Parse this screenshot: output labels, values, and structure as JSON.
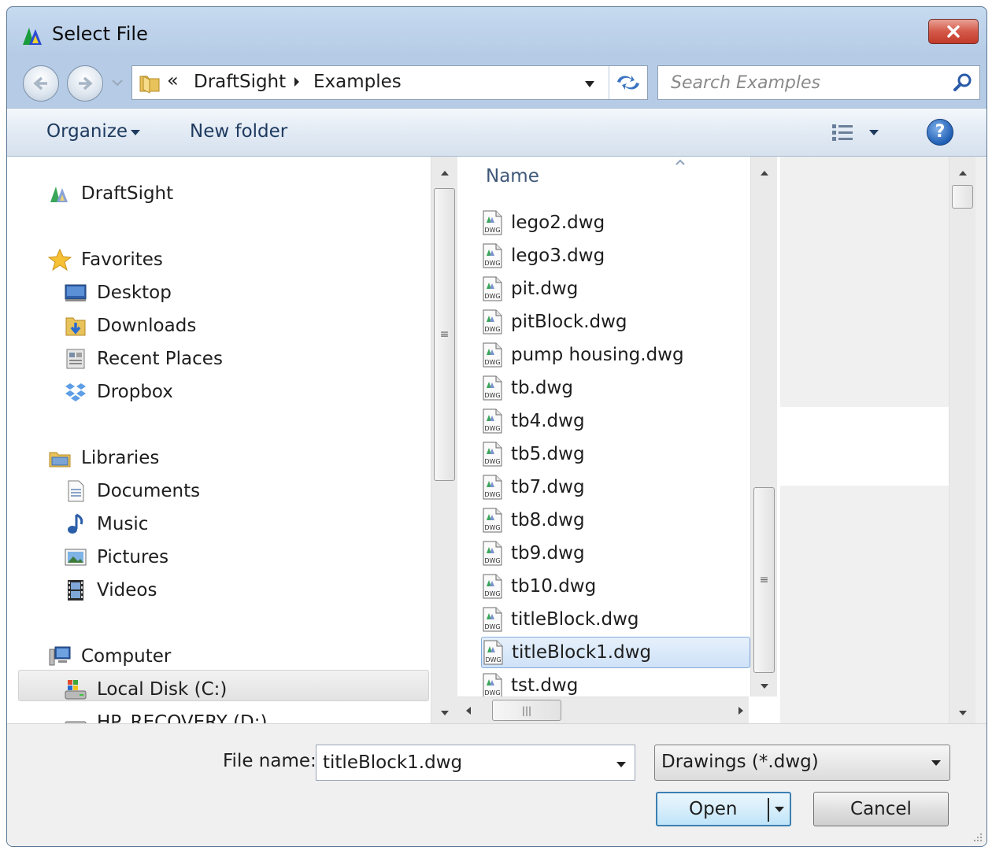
{
  "window": {
    "title": "Select File"
  },
  "address": {
    "overflow": "«",
    "crumbs": [
      "DraftSight",
      "Examples"
    ]
  },
  "search": {
    "placeholder": "Search Examples"
  },
  "toolbar": {
    "organize": "Organize",
    "new_folder": "New folder"
  },
  "nav": {
    "items": [
      {
        "label": "DraftSight",
        "icon": "draftsight-icon"
      },
      {
        "label": "Favorites",
        "icon": "star-icon"
      },
      {
        "label": "Desktop",
        "icon": "desktop-icon"
      },
      {
        "label": "Downloads",
        "icon": "downloads-icon"
      },
      {
        "label": "Recent Places",
        "icon": "recent-places-icon"
      },
      {
        "label": "Dropbox",
        "icon": "dropbox-icon"
      },
      {
        "label": "Libraries",
        "icon": "libraries-icon"
      },
      {
        "label": "Documents",
        "icon": "documents-icon"
      },
      {
        "label": "Music",
        "icon": "music-icon"
      },
      {
        "label": "Pictures",
        "icon": "pictures-icon"
      },
      {
        "label": "Videos",
        "icon": "videos-icon"
      },
      {
        "label": "Computer",
        "icon": "computer-icon"
      },
      {
        "label": "Local Disk (C:)",
        "icon": "local-disk-icon"
      },
      {
        "label": "HP_RECOVERY (D:)",
        "icon": "drive-icon"
      }
    ],
    "selected": "Local Disk (C:)"
  },
  "files": {
    "column_header": "Name",
    "items": [
      "lego2.dwg",
      "lego3.dwg",
      "pit.dwg",
      "pitBlock.dwg",
      "pump housing.dwg",
      "tb.dwg",
      "tb4.dwg",
      "tb5.dwg",
      "tb7.dwg",
      "tb8.dwg",
      "tb9.dwg",
      "tb10.dwg",
      "titleBlock.dwg",
      "titleBlock1.dwg",
      "tst.dwg"
    ],
    "selected": "titleBlock1.dwg",
    "icon_label": "DWG"
  },
  "bottom": {
    "file_name_label": "File name:",
    "file_name_value": "titleBlock1.dwg",
    "file_type": "Drawings (*.dwg)",
    "open_label": "Open",
    "cancel_label": "Cancel"
  },
  "colors": {
    "accent": "#3c7fb1",
    "selection": "#cfe2f8",
    "chrome": "#b9cfe8"
  }
}
